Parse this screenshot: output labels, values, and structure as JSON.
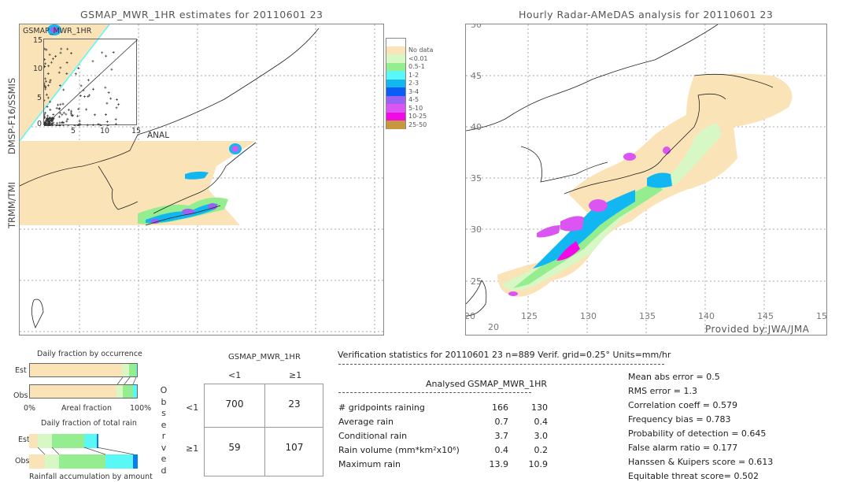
{
  "left_map": {
    "title": "GSMAP_MWR_1HR estimates for 20110601 23",
    "sensor_labels": [
      "DMSP-F16/SSMIS",
      "TRMM/TMI"
    ],
    "inset": {
      "label": "GSMAP_MWR_1HR",
      "x_label": "ANAL",
      "y_ticks": [
        "15",
        "10",
        "5",
        "0"
      ],
      "x_ticks": [
        "5",
        "10",
        "15"
      ]
    }
  },
  "right_map": {
    "title": "Hourly Radar-AMeDAS analysis for 20110601 23",
    "lat_ticks": [
      "50",
      "45",
      "40",
      "35",
      "30",
      "25",
      "20"
    ],
    "lon_ticks": [
      "20",
      "125",
      "130",
      "135",
      "140",
      "145",
      "15"
    ],
    "credit": "Provided by:JWA/JMA"
  },
  "legend": {
    "items": [
      {
        "label": "",
        "color": "#ffffff"
      },
      {
        "label": "No data",
        "color": "#fbe3b8"
      },
      {
        "label": "<0.01",
        "color": "#d7f7c4"
      },
      {
        "label": "0.5-1",
        "color": "#94ee90"
      },
      {
        "label": "1-2",
        "color": "#5af7f7"
      },
      {
        "label": "2-3",
        "color": "#12b7f2"
      },
      {
        "label": "3-4",
        "color": "#0a5ef5"
      },
      {
        "label": "4-5",
        "color": "#9a62f2"
      },
      {
        "label": "5-10",
        "color": "#db55f2"
      },
      {
        "label": "10-25",
        "color": "#f20ae6"
      },
      {
        "label": "25-50",
        "color": "#c8963c"
      }
    ]
  },
  "occurrence": {
    "title": "Daily fraction by occurrence",
    "est_label": "Est",
    "obs_label": "Obs",
    "axis_left": "0%",
    "axis_mid": "Areal fraction",
    "axis_right": "100%",
    "est_fractions": [
      0.86,
      0.07,
      0.06,
      0.01
    ],
    "obs_fractions": [
      0.81,
      0.06,
      0.09,
      0.04
    ]
  },
  "total_rain": {
    "title": "Daily fraction of total rain",
    "est_label": "Est",
    "obs_label": "Obs",
    "caption": "Rainfall accumulation by amount",
    "est_fractions": [
      0.08,
      0.13,
      0.3,
      0.11,
      0.02
    ],
    "obs_fractions": [
      0.145,
      0.13,
      0.425,
      0.26,
      0.04
    ]
  },
  "contingency": {
    "title": "GSMAP_MWR_1HR",
    "col_headers": [
      "<1",
      "≥1"
    ],
    "row_headers": [
      "<1",
      "≥1"
    ],
    "observed_label": [
      "O",
      "b",
      "s",
      "e",
      "r",
      "v",
      "e",
      "d"
    ],
    "cells": [
      [
        "700",
        "23"
      ],
      [
        "59",
        "107"
      ]
    ]
  },
  "stats": {
    "header": "Verification statistics for 20110601 23   n=889   Verif. grid=0.25°   Units=mm/hr",
    "col_analysed": "Analysed",
    "col_gsmap": "GSMAP_MWR_1HR",
    "rows": [
      {
        "label": "# gridpoints raining",
        "analysed": "166",
        "gsmap": "130"
      },
      {
        "label": "Average rain",
        "analysed": "0.7",
        "gsmap": "0.4"
      },
      {
        "label": "Conditional rain",
        "analysed": "3.7",
        "gsmap": "3.0"
      },
      {
        "label": "Rain volume (mm*km²x10⁶)",
        "analysed": "0.4",
        "gsmap": "0.2"
      },
      {
        "label": "Maximum rain",
        "analysed": "13.9",
        "gsmap": "10.9"
      }
    ],
    "scores": [
      "Mean abs error = 0.5",
      "RMS error = 1.3",
      "Correlation coeff = 0.579",
      "Frequency bias = 0.783",
      "Probability of detection = 0.645",
      "False alarm ratio = 0.177",
      "Hanssen & Kuipers score = 0.613",
      "Equitable threat score= 0.502"
    ]
  }
}
